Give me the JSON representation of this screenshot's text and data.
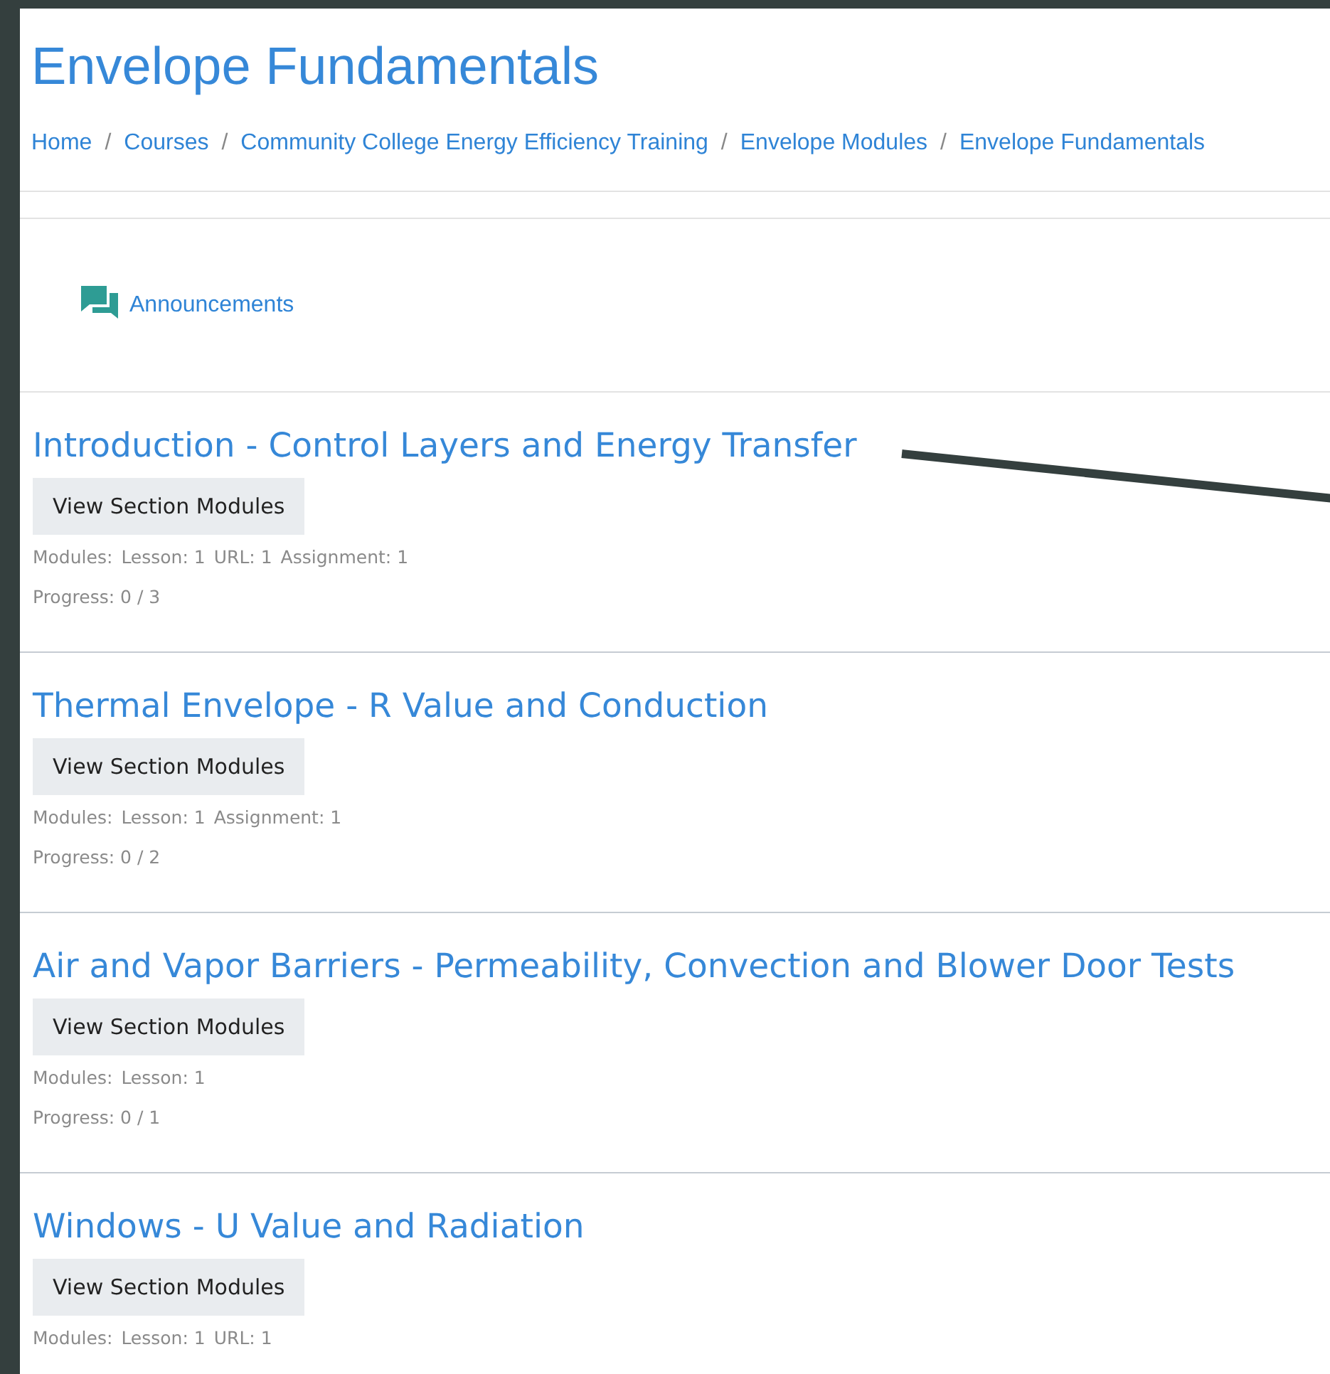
{
  "page_title": "Envelope Fundamentals",
  "breadcrumb": {
    "separator": "/",
    "items": [
      "Home",
      "Courses",
      "Community College Energy Efficiency Training",
      "Envelope Modules",
      "Envelope Fundamentals"
    ]
  },
  "announcements": {
    "label": "Announcements"
  },
  "sections": [
    {
      "title": "Introduction - Control Layers and Energy Transfer",
      "button": "View Section Modules",
      "modules_label": "Modules:",
      "modules": [
        "Lesson: 1",
        "URL: 1",
        "Assignment: 1"
      ],
      "progress": "Progress: 0 / 3"
    },
    {
      "title": "Thermal Envelope - R Value and Conduction",
      "button": "View Section Modules",
      "modules_label": "Modules:",
      "modules": [
        "Lesson: 1",
        "Assignment: 1"
      ],
      "progress": "Progress: 0 / 2"
    },
    {
      "title": "Air and Vapor Barriers - Permeability, Convection and Blower Door Tests",
      "button": "View Section Modules",
      "modules_label": "Modules:",
      "modules": [
        "Lesson: 1"
      ],
      "progress": "Progress: 0 / 1"
    },
    {
      "title": "Windows - U Value and Radiation",
      "button": "View Section Modules",
      "modules_label": "Modules:",
      "modules": [
        "Lesson: 1",
        "URL: 1"
      ]
    }
  ]
}
